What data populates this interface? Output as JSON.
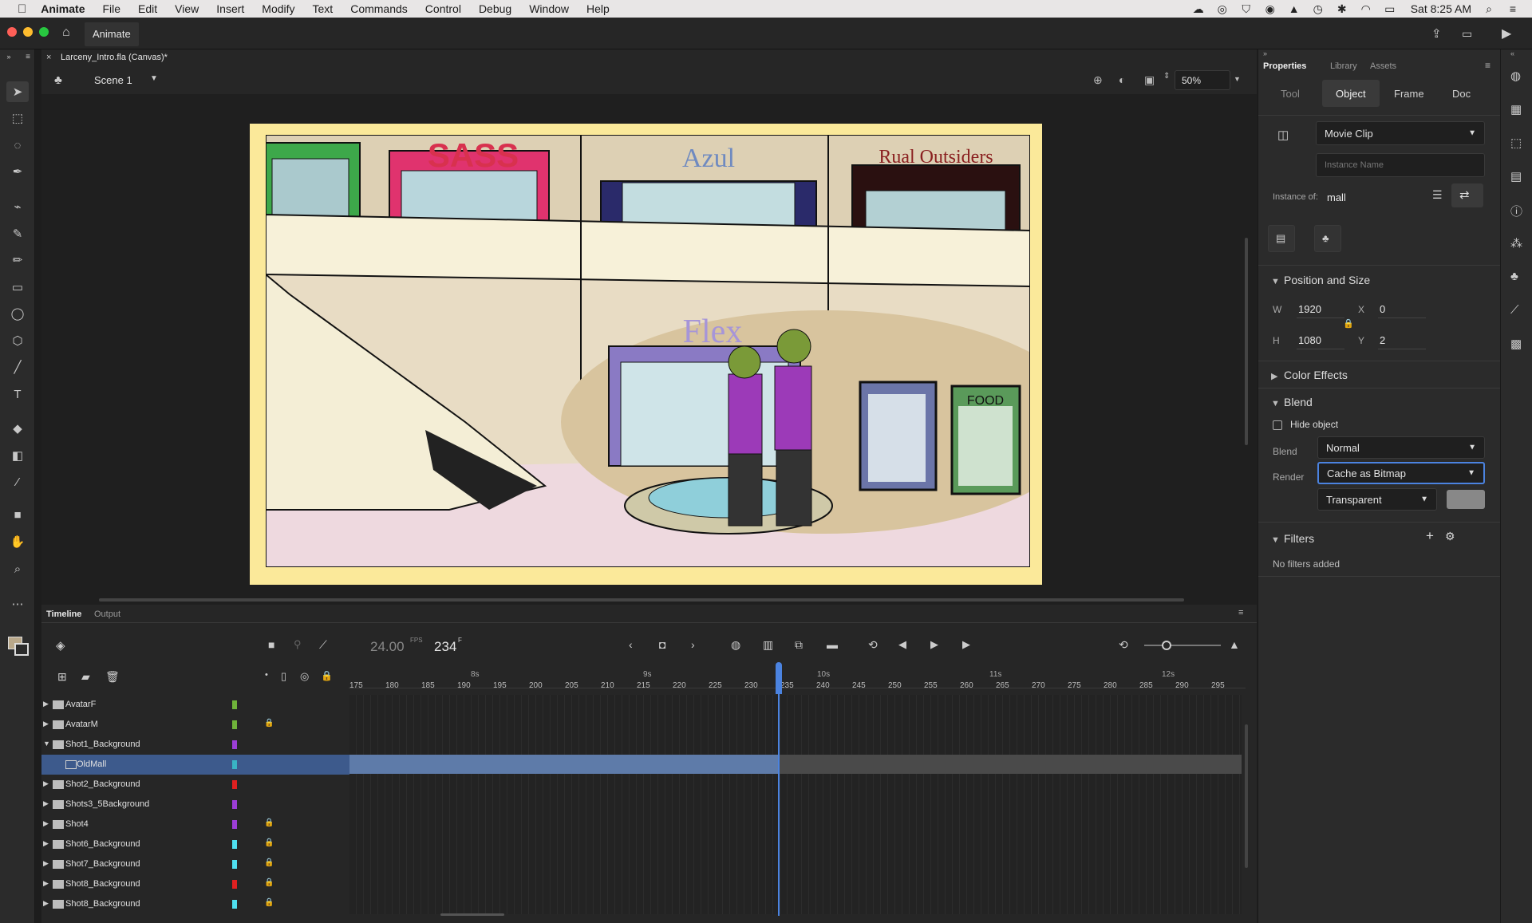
{
  "menubar": {
    "apple": "",
    "app": "Animate",
    "items": [
      "File",
      "Edit",
      "View",
      "Insert",
      "Modify",
      "Text",
      "Commands",
      "Control",
      "Debug",
      "Window",
      "Help"
    ],
    "clock": "Sat 8:25 AM"
  },
  "appbar": {
    "title": "Animate"
  },
  "document": {
    "tab": "Larceny_Intro.fla (Canvas)*",
    "close": "×"
  },
  "stagebar": {
    "scene": "Scene 1",
    "zoom": "50%"
  },
  "canvas": {
    "signs": {
      "sass": "SASS",
      "azul": "Azul",
      "rural": "Rual Outsiders",
      "flex": "Flex",
      "food": "FOOD"
    }
  },
  "timeline": {
    "tabs": [
      "Timeline",
      "Output"
    ],
    "fps": "24.00",
    "fps_unit": "FPS",
    "frame": "234",
    "frame_unit": "F",
    "seconds": [
      "8s",
      "9s",
      "10s",
      "11s",
      "12s"
    ],
    "frames": [
      "175",
      "180",
      "185",
      "190",
      "195",
      "200",
      "205",
      "210",
      "215",
      "220",
      "225",
      "230",
      "235",
      "240",
      "245",
      "250",
      "255",
      "260",
      "265",
      "270",
      "275",
      "280",
      "285",
      "290",
      "295"
    ],
    "layers": [
      {
        "name": "AvatarF",
        "color": "#6fb43a",
        "locked": false,
        "expanded": false,
        "child": false
      },
      {
        "name": "AvatarM",
        "color": "#6fb43a",
        "locked": true,
        "expanded": false,
        "child": false
      },
      {
        "name": "Shot1_Background",
        "color": "#9c3ed6",
        "locked": false,
        "expanded": true,
        "child": false
      },
      {
        "name": "OldMall",
        "color": "#39b4c4",
        "locked": false,
        "expanded": false,
        "child": true
      },
      {
        "name": "Shot2_Background",
        "color": "#e02020",
        "locked": false,
        "expanded": false,
        "child": false
      },
      {
        "name": "Shots3_5Background",
        "color": "#9c3ed6",
        "locked": false,
        "expanded": false,
        "child": false
      },
      {
        "name": "Shot4",
        "color": "#9c3ed6",
        "locked": true,
        "expanded": false,
        "child": false
      },
      {
        "name": "Shot6_Background",
        "color": "#4fe0f0",
        "locked": true,
        "expanded": false,
        "child": false
      },
      {
        "name": "Shot7_Background",
        "color": "#4fe0f0",
        "locked": true,
        "expanded": false,
        "child": false
      },
      {
        "name": "Shot8_Background",
        "color": "#e02020",
        "locked": true,
        "expanded": false,
        "child": false
      },
      {
        "name": "Shot8_Background",
        "color": "#4fe0f0",
        "locked": true,
        "expanded": false,
        "child": false
      }
    ]
  },
  "props": {
    "tabs": [
      "Properties",
      "Library",
      "Assets"
    ],
    "subtabs": [
      "Tool",
      "Object",
      "Frame",
      "Doc"
    ],
    "symbol_type": "Movie Clip",
    "instance_placeholder": "Instance Name",
    "instance_of_label": "Instance of:",
    "instance_of": "mall",
    "position": {
      "title": "Position and Size",
      "w_label": "W",
      "w": "1920",
      "h_label": "H",
      "h": "1080",
      "x_label": "X",
      "x": "0",
      "y_label": "Y",
      "y": "2"
    },
    "color_effects": "Color Effects",
    "blend": {
      "title": "Blend",
      "hide": "Hide object",
      "blend_label": "Blend",
      "blend_value": "Normal",
      "render_label": "Render",
      "render_value": "Cache as Bitmap",
      "bg_value": "Transparent"
    },
    "filters": {
      "title": "Filters",
      "empty": "No filters added"
    }
  },
  "colors": {
    "accent": "#4b83e0",
    "selected_row": "#3d5a8c",
    "stage_border": "#fbe99a"
  }
}
